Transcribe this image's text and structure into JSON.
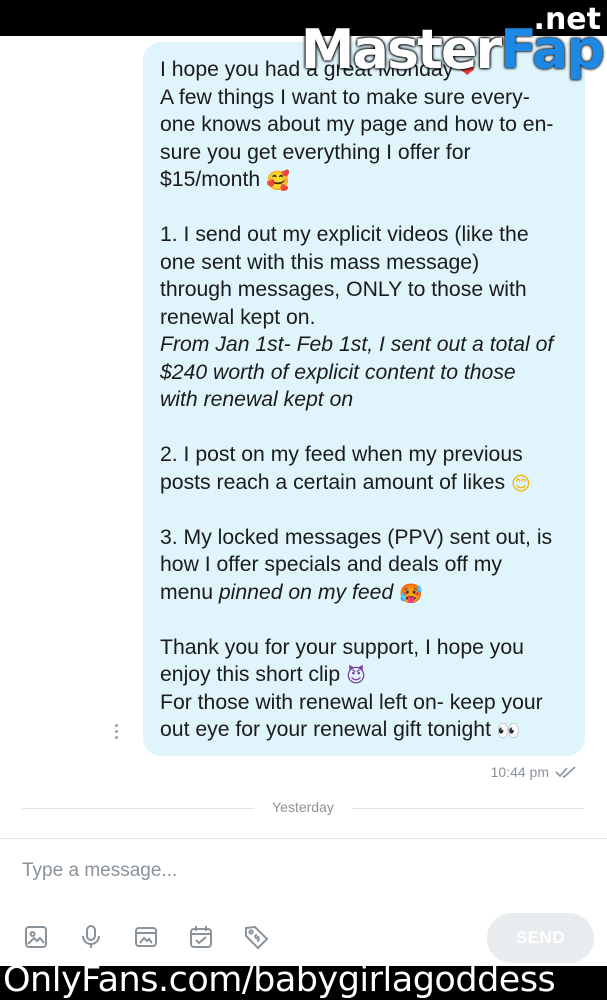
{
  "watermark": {
    "net": ".net",
    "master": "Master",
    "fap": "Fap"
  },
  "message": {
    "intro_1": "I hope you had a great Monday ",
    "intro_1_emoji": "❤",
    "intro_2": "A few things I want to make sure every-",
    "intro_3": "one knows about my page and how to en-",
    "intro_4": "sure you get everything I offer for",
    "intro_5": "$15/month ",
    "intro_5_emoji": "🥰",
    "p1_1": "1. I send out my explicit videos (like the",
    "p1_2": "one sent with this mass message)",
    "p1_3": "through messages, ONLY to those with",
    "p1_4": "renewal kept on.",
    "p1_5": "From Jan 1st- Feb 1st, I sent out a total of",
    "p1_6": "$240 worth of explicit content to those",
    "p1_7": "with renewal kept on",
    "p2_1": "2. I post on my feed when my previous",
    "p2_2": "posts reach a certain amount of likes ",
    "p2_2_emoji": "😊",
    "p3_1": "3. My locked messages (PPV) sent out, is",
    "p3_2": "how I offer specials and deals off my",
    "p3_3a": "menu ",
    "p3_3b": "pinned on my feed ",
    "p3_3_emoji": "🥵",
    "p4_1": "Thank you for your support, I hope you",
    "p4_2": "enjoy this short clip ",
    "p4_2_emoji": "😈",
    "p4_3": "For those with renewal left on- keep your",
    "p4_4": "out eye for your renewal gift tonight ",
    "p4_4_emoji": "👀"
  },
  "message_time": "10:44 pm",
  "date_separator": "Yesterday",
  "composer": {
    "placeholder": "Type a message..."
  },
  "tools": [
    "image-icon",
    "microphone-icon",
    "media-vault-icon",
    "calendar-icon",
    "price-tag-icon"
  ],
  "send_label": "SEND",
  "footer_watermark": "OnlyFans.com/babygirlagoddess",
  "colors": {
    "bubble": "#dff4fb",
    "icon_gray": "#8a929a",
    "fap_blue": "#1e88e5"
  }
}
